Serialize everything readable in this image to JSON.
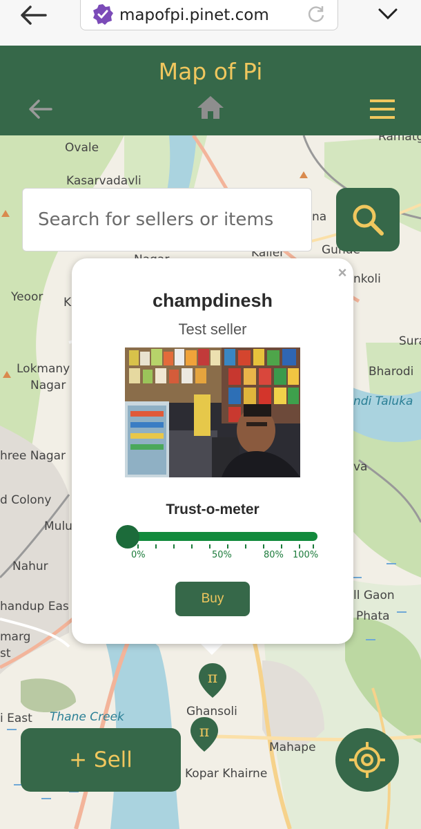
{
  "browser": {
    "url": "mapofpi.pinet.com",
    "icons": [
      "back-arrow-icon",
      "verified-icon",
      "reload-icon",
      "chevron-down-icon"
    ]
  },
  "header": {
    "title": "Map of Pi",
    "icons": [
      "back-arrow-icon",
      "home-icon",
      "hamburger-menu-icon"
    ]
  },
  "search": {
    "placeholder": "Search for sellers or items"
  },
  "map_labels": [
    "Ovale",
    "Kasarvadavli",
    "Ramatgha",
    "Yeoor",
    "K",
    "nkoli",
    "Sura",
    "Lokmany",
    "Nagar",
    "Bharodi",
    "ndi Taluka",
    "hree Nagar",
    "d Colony",
    "Mulu",
    "va",
    "Nahur",
    "handup Eas",
    "marg",
    "st",
    "ll Gaon",
    "Phata",
    "i East",
    "Thane Creek",
    "Ghansoli",
    "Mahape",
    "Kopar Khairne",
    "Gunde",
    "Nagar",
    "Kailer",
    "na"
  ],
  "popup": {
    "close": "×",
    "seller_name": "champdinesh",
    "seller_description": "Test seller",
    "trust_label": "Trust-o-meter",
    "trust_value_percent": 0,
    "trust_ticks": [
      "0%",
      "50%",
      "80%",
      "100%"
    ],
    "buy_label": "Buy"
  },
  "bottom": {
    "sell_label": "+ Sell"
  },
  "colors": {
    "brand_green": "#366849",
    "brand_gold": "#f0c75e",
    "trust_green": "#128a3c"
  }
}
